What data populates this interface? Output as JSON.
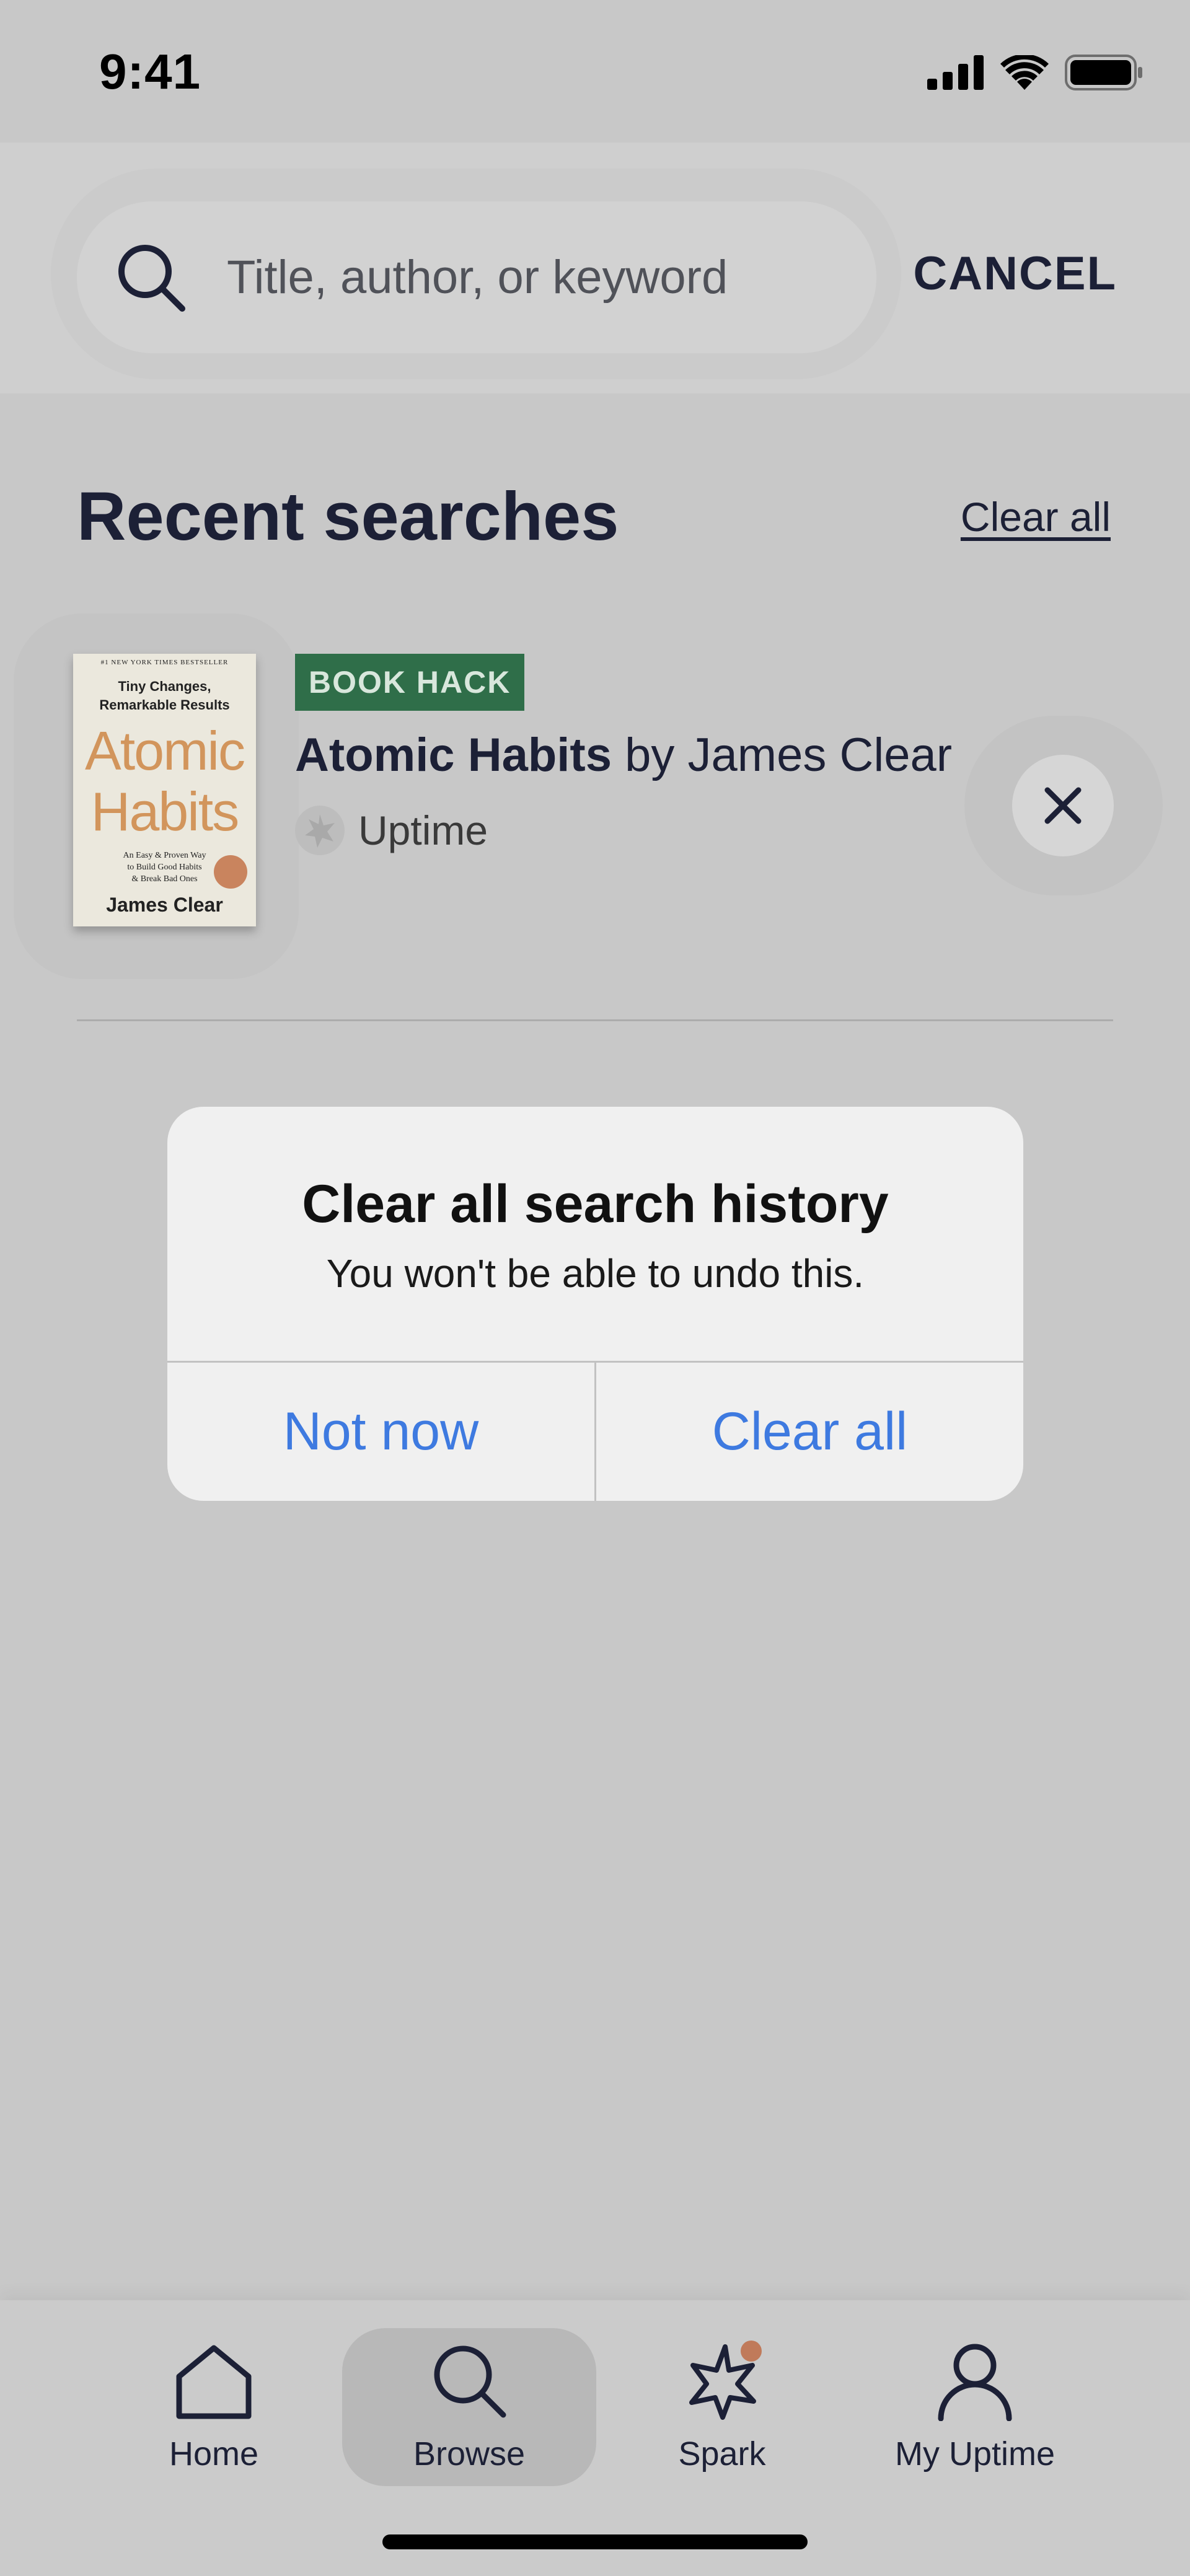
{
  "status_bar": {
    "time": "9:41"
  },
  "search": {
    "placeholder": "Title, author, or keyword",
    "cancel_label": "CANCEL"
  },
  "recent": {
    "title": "Recent searches",
    "clear_all_label": "Clear all",
    "items": [
      {
        "badge": "BOOK HACK",
        "book_title": "Atomic Habits",
        "by": "by",
        "author": "James Clear",
        "source": "Uptime",
        "cover": {
          "top_line": "#1 NEW YORK TIMES BESTSELLER",
          "subtitle_1": "Tiny Changes,",
          "subtitle_2": "Remarkable Results",
          "title_1": "Atomic",
          "title_2": "Habits",
          "tagline_1": "An Easy & Proven Way",
          "tagline_2": "to Build Good Habits",
          "tagline_3": "& Break Bad Ones",
          "author": "James Clear"
        }
      }
    ]
  },
  "dialog": {
    "title": "Clear all search history",
    "message": "You won't be able to undo this.",
    "cancel_label": "Not now",
    "confirm_label": "Clear all",
    "button_color": "#3e7ae0"
  },
  "tabbar": {
    "active": "browse",
    "tabs": [
      {
        "id": "home",
        "label": "Home",
        "icon": "home-icon"
      },
      {
        "id": "browse",
        "label": "Browse",
        "icon": "search-icon"
      },
      {
        "id": "spark",
        "label": "Spark",
        "icon": "spark-icon",
        "has_badge": true
      },
      {
        "id": "my-uptime",
        "label": "My Uptime",
        "icon": "person-icon"
      }
    ]
  }
}
